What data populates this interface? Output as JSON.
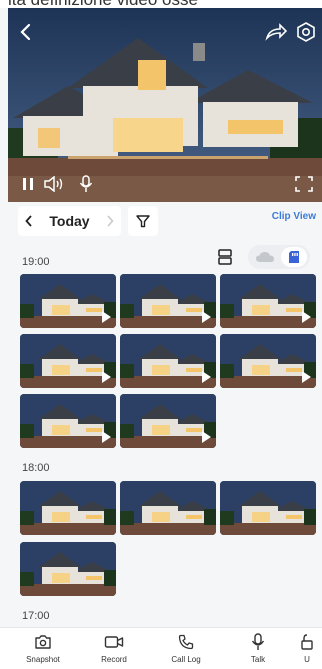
{
  "banner_text": "lta definizione video osse",
  "date_nav": {
    "label": "Today"
  },
  "clip_view_label": "Clip View",
  "sections": [
    {
      "time": "19:00",
      "clips": 8
    },
    {
      "time": "18:00",
      "clips": 4
    },
    {
      "time": "17:00",
      "clips": 0
    }
  ],
  "bottom_bar": {
    "items": [
      {
        "label": "Snapshot",
        "icon": "camera-icon"
      },
      {
        "label": "Record",
        "icon": "video-record-icon"
      },
      {
        "label": "Call Log",
        "icon": "phone-icon"
      },
      {
        "label": "Talk",
        "icon": "microphone-icon"
      },
      {
        "label": "U",
        "icon": "unlock-icon"
      }
    ]
  },
  "colors": {
    "accent": "#3b7bd8",
    "sd_active": "#3b63d8"
  }
}
